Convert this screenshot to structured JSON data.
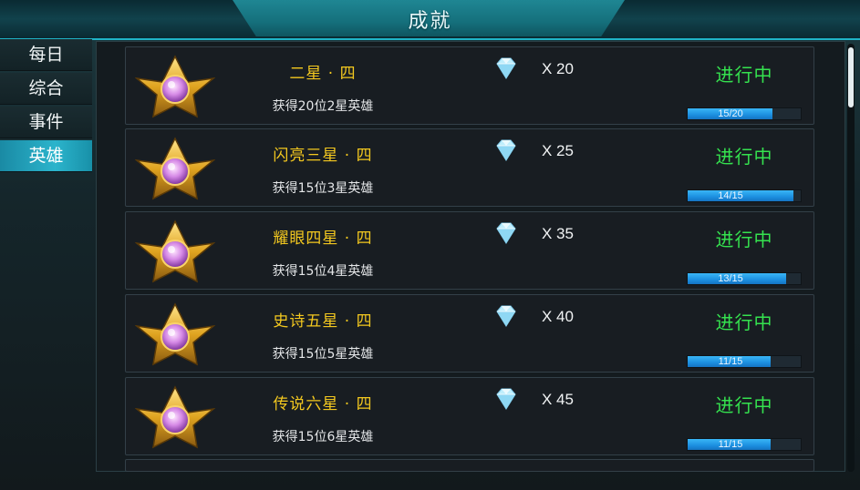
{
  "window": {
    "title": "成就"
  },
  "sidebar": {
    "tabs": [
      {
        "label": "每日",
        "active": false
      },
      {
        "label": "综合",
        "active": false
      },
      {
        "label": "事件",
        "active": false
      },
      {
        "label": "英雄",
        "active": true
      }
    ]
  },
  "achievements": [
    {
      "name": "二星 · 四",
      "desc": "获得20位2星英雄",
      "reward": "X 20",
      "status": "进行中",
      "progress": "15/20",
      "fraction": 0.75
    },
    {
      "name": "闪亮三星 · 四",
      "desc": "获得15位3星英雄",
      "reward": "X 25",
      "status": "进行中",
      "progress": "14/15",
      "fraction": 0.933
    },
    {
      "name": "耀眼四星 · 四",
      "desc": "获得15位4星英雄",
      "reward": "X 35",
      "status": "进行中",
      "progress": "13/15",
      "fraction": 0.867
    },
    {
      "name": "史诗五星 · 四",
      "desc": "获得15位5星英雄",
      "reward": "X 40",
      "status": "进行中",
      "progress": "11/15",
      "fraction": 0.733
    },
    {
      "name": "传说六星 · 四",
      "desc": "获得15位6星英雄",
      "reward": "X 45",
      "status": "进行中",
      "progress": "11/15",
      "fraction": 0.733
    }
  ],
  "icons": {
    "badge": "gold-star-badge-icon",
    "reward": "diamond-icon"
  },
  "colors": {
    "accent": "#2bb4cc",
    "title_gold": "#f3c81f",
    "status_green": "#35e24f",
    "bar_blue": "#1c8fe0"
  }
}
